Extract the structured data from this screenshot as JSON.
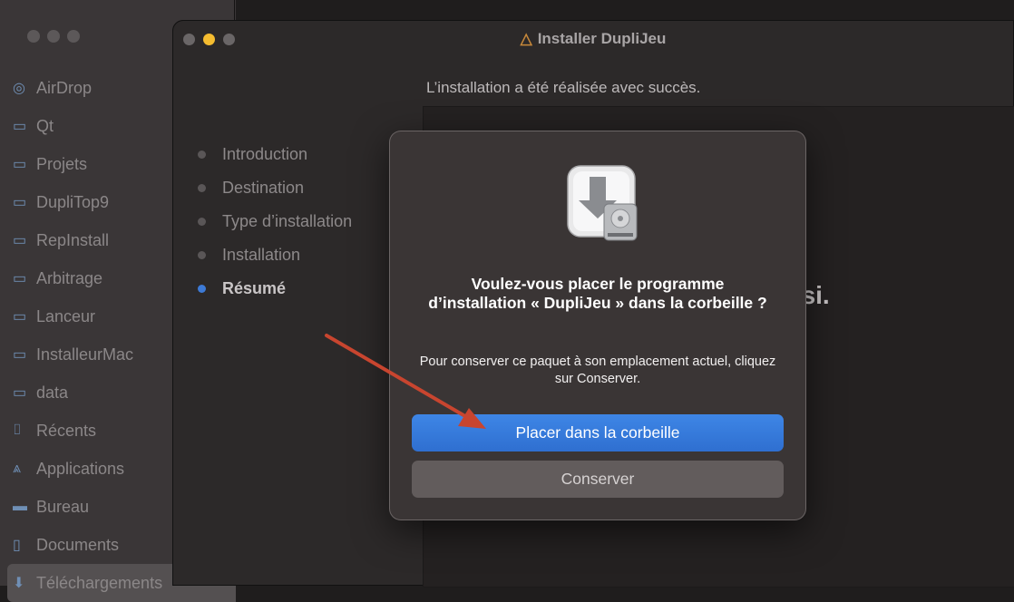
{
  "finder": {
    "items": [
      {
        "label": "AirDrop",
        "icon": "airdrop-icon"
      },
      {
        "label": "Qt",
        "icon": "folder-icon"
      },
      {
        "label": "Projets",
        "icon": "folder-icon"
      },
      {
        "label": "DupliTop9",
        "icon": "folder-icon"
      },
      {
        "label": "RepInstall",
        "icon": "folder-icon"
      },
      {
        "label": "Arbitrage",
        "icon": "folder-icon"
      },
      {
        "label": "Lanceur",
        "icon": "folder-icon"
      },
      {
        "label": "InstalleurMac",
        "icon": "folder-icon"
      },
      {
        "label": "data",
        "icon": "folder-icon"
      },
      {
        "label": "Récents",
        "icon": "recents-icon"
      },
      {
        "label": "Applications",
        "icon": "applications-icon"
      },
      {
        "label": "Bureau",
        "icon": "desktop-icon"
      },
      {
        "label": "Documents",
        "icon": "document-icon"
      },
      {
        "label": "Téléchargements",
        "icon": "download-icon"
      }
    ]
  },
  "installer": {
    "title": "Installer DupliJeu",
    "heading": "L’installation a été réalisée avec succès.",
    "behind_text": "ssi.",
    "steps": [
      {
        "label": "Introduction",
        "active": false
      },
      {
        "label": "Destination",
        "active": false
      },
      {
        "label": "Type d’installation",
        "active": false
      },
      {
        "label": "Installation",
        "active": false
      },
      {
        "label": "Résumé",
        "active": true
      }
    ]
  },
  "dialog": {
    "icon": "installer-package-icon",
    "title": "Voulez-vous placer le programme d’installation « DupliJeu » dans la corbeille ?",
    "message": "Pour conserver ce paquet à son emplacement actuel, cliquez sur Conserver.",
    "primary_button": "Placer dans la corbeille",
    "secondary_button": "Conserver"
  },
  "colors": {
    "accent": "#3e86e6",
    "annotation": "#c8452f",
    "traffic_red": "#5c5859",
    "traffic_yellow": "#f5bc30"
  }
}
